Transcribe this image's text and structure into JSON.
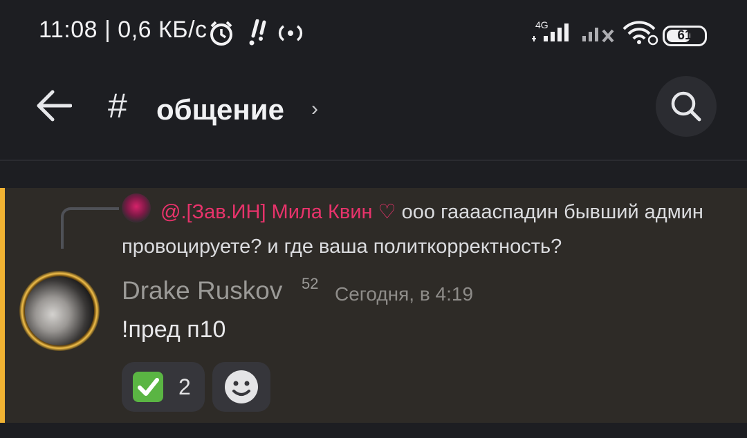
{
  "status_bar": {
    "time_speed": "11:08 | 0,6 КБ/с",
    "network_type": "4G",
    "battery": "61",
    "icons": [
      "alarm-icon",
      "notification-icon",
      "hotspot-icon",
      "signal-4g-icon",
      "signal-no-sim-icon",
      "wifi-icon",
      "battery-icon"
    ]
  },
  "header": {
    "channel_prefix": "#",
    "channel_name": "общение",
    "chevron": "›"
  },
  "reply": {
    "mention": "@.[Зав.ИН] Мила Квин ♡",
    "text": "ооо гаааaспадин бывший админ провоцируете? и где ваша политкорректность?"
  },
  "message": {
    "username": "Drake Ruskov",
    "badge": "52",
    "timestamp": "Сегодня, в 4:19",
    "content": "!пред п10"
  },
  "reactions": [
    {
      "emoji": "check-mark-emoji",
      "count": "2"
    }
  ],
  "colors": {
    "accent_bar": "#f0b232",
    "mention": "#e8336b",
    "reaction_bg": "#36363b"
  }
}
